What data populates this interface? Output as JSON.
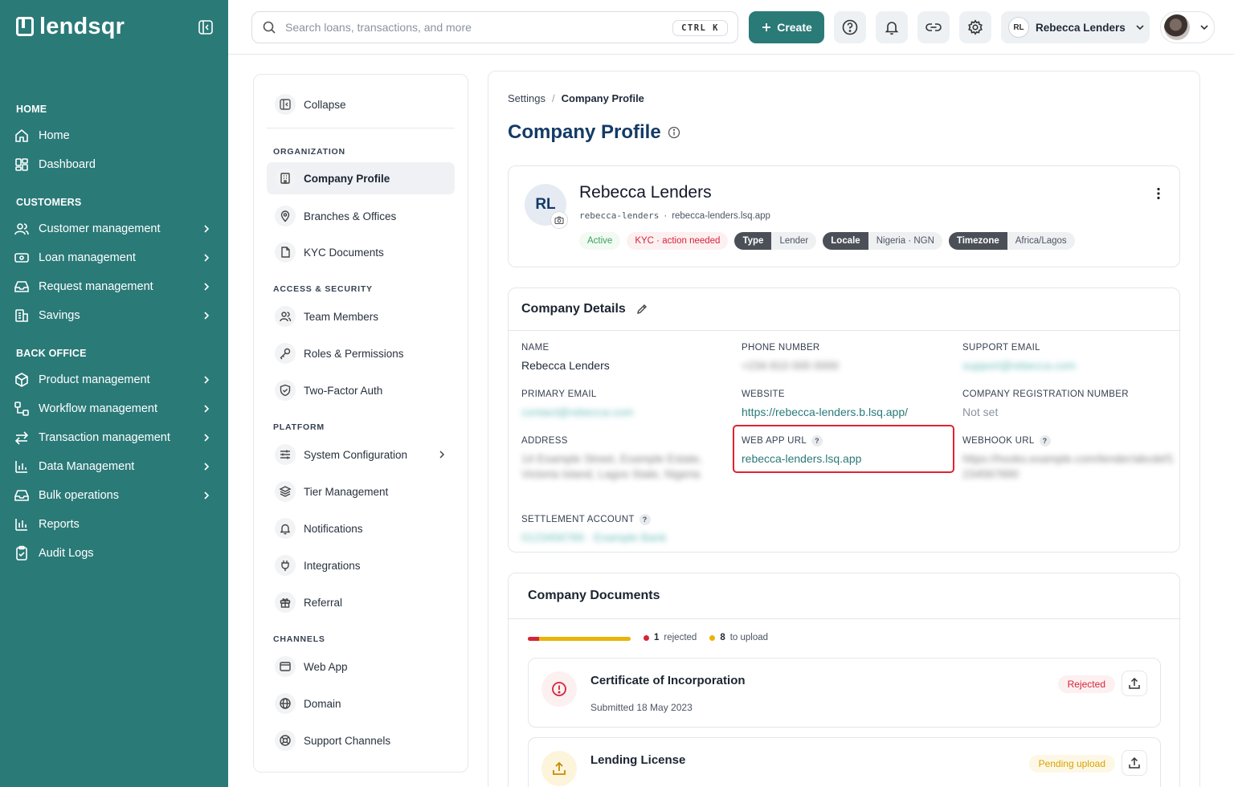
{
  "brand": {
    "name": "lendsqr",
    "accent": "#2a7a78",
    "title_color": "#143a66"
  },
  "sidebar": {
    "sections": [
      {
        "title": "HOME",
        "items": [
          {
            "label": "Home",
            "icon": "home-icon",
            "chevron": false
          },
          {
            "label": "Dashboard",
            "icon": "dashboard-icon",
            "chevron": false
          }
        ]
      },
      {
        "title": "CUSTOMERS",
        "items": [
          {
            "label": "Customer management",
            "icon": "users-icon",
            "chevron": true
          },
          {
            "label": "Loan management",
            "icon": "loan-icon",
            "chevron": true
          },
          {
            "label": "Request management",
            "icon": "inbox-icon",
            "chevron": true
          },
          {
            "label": "Savings",
            "icon": "bank-icon",
            "chevron": true
          }
        ]
      },
      {
        "title": "BACK OFFICE",
        "items": [
          {
            "label": "Product management",
            "icon": "box-icon",
            "chevron": true
          },
          {
            "label": "Workflow management",
            "icon": "workflow-icon",
            "chevron": true
          },
          {
            "label": "Transaction management",
            "icon": "transfer-icon",
            "chevron": true
          },
          {
            "label": "Data Management",
            "icon": "chart-icon",
            "chevron": true
          },
          {
            "label": "Bulk operations",
            "icon": "inbox-icon",
            "chevron": true
          },
          {
            "label": "Reports",
            "icon": "bar-chart-icon",
            "chevron": false
          },
          {
            "label": "Audit Logs",
            "icon": "clipboard-icon",
            "chevron": false
          }
        ]
      }
    ]
  },
  "topbar": {
    "search_placeholder": "Search loans, transactions, and more",
    "shortcut": "CTRL K",
    "create_label": "Create",
    "user_initials": "RL",
    "user_name": "Rebecca Lenders"
  },
  "settings_menu": {
    "collapse_label": "Collapse",
    "sections": [
      {
        "title": "ORGANIZATION",
        "items": [
          {
            "label": "Company Profile",
            "icon": "building-icon",
            "active": true
          },
          {
            "label": "Branches & Offices",
            "icon": "map-pin-icon"
          },
          {
            "label": "KYC Documents",
            "icon": "document-icon"
          }
        ]
      },
      {
        "title": "ACCESS & SECURITY",
        "items": [
          {
            "label": "Team Members",
            "icon": "users-icon"
          },
          {
            "label": "Roles & Permissions",
            "icon": "key-icon"
          },
          {
            "label": "Two-Factor Auth",
            "icon": "shield-icon"
          }
        ]
      },
      {
        "title": "PLATFORM",
        "items": [
          {
            "label": "System Configuration",
            "icon": "sliders-icon",
            "chevron": true
          },
          {
            "label": "Tier Management",
            "icon": "layers-icon"
          },
          {
            "label": "Notifications",
            "icon": "bell-icon"
          },
          {
            "label": "Integrations",
            "icon": "plug-icon"
          },
          {
            "label": "Referral",
            "icon": "gift-icon"
          }
        ]
      },
      {
        "title": "CHANNELS",
        "items": [
          {
            "label": "Web App",
            "icon": "browser-icon"
          },
          {
            "label": "Domain",
            "icon": "globe-icon"
          },
          {
            "label": "Support Channels",
            "icon": "lifebuoy-icon"
          }
        ]
      }
    ]
  },
  "breadcrumb": {
    "parent": "Settings",
    "current": "Company Profile"
  },
  "page_title": "Company Profile",
  "profile": {
    "initials": "RL",
    "name": "Rebecca Lenders",
    "slug": "rebecca-lenders",
    "domain": "rebecca-lenders.lsq.app",
    "status_active": "Active",
    "status_kyc": "KYC · action needed",
    "type_key": "Type",
    "type_value": "Lender",
    "locale_key": "Locale",
    "locale_value": "Nigeria · NGN",
    "timezone_key": "Timezone",
    "timezone_value": "Africa/Lagos"
  },
  "company_details": {
    "title": "Company Details",
    "fields": {
      "name": {
        "label": "NAME",
        "value": "Rebecca Lenders"
      },
      "phone": {
        "label": "PHONE NUMBER",
        "value": "+234 810 000 0000"
      },
      "support_email": {
        "label": "SUPPORT EMAIL",
        "value": "support@rebecca.com"
      },
      "primary_email": {
        "label": "PRIMARY EMAIL",
        "value": "contact@rebecca.com"
      },
      "website": {
        "label": "WEBSITE",
        "value": "https://rebecca-lenders.b.lsq.app/"
      },
      "registration": {
        "label": "COMPANY REGISTRATION NUMBER",
        "value": "Not set"
      },
      "address": {
        "label": "ADDRESS",
        "value": "14 Example Street, Example Estate, Victoria Island, Lagos State, Nigeria"
      },
      "web_app_url": {
        "label": "WEB APP URL",
        "value": "rebecca-lenders.lsq.app"
      },
      "webhook_url": {
        "label": "WEBHOOK URL",
        "value": "https://hooks.example.com/lender/abcdef1234567890"
      },
      "settlement": {
        "label": "SETTLEMENT ACCOUNT",
        "value": "0123456789 · Example Bank"
      }
    },
    "help_glyph": "?"
  },
  "documents": {
    "title": "Company Documents",
    "rejected_count": "1",
    "rejected_label": "rejected",
    "upload_count": "8",
    "upload_label": "to upload",
    "rejected_fraction": 0.11,
    "items": [
      {
        "title": "Certificate of Incorporation",
        "subtitle": "Submitted 18 May 2023",
        "status": "Rejected"
      },
      {
        "title": "Lending License",
        "subtitle": "",
        "status": "Pending upload"
      }
    ]
  }
}
